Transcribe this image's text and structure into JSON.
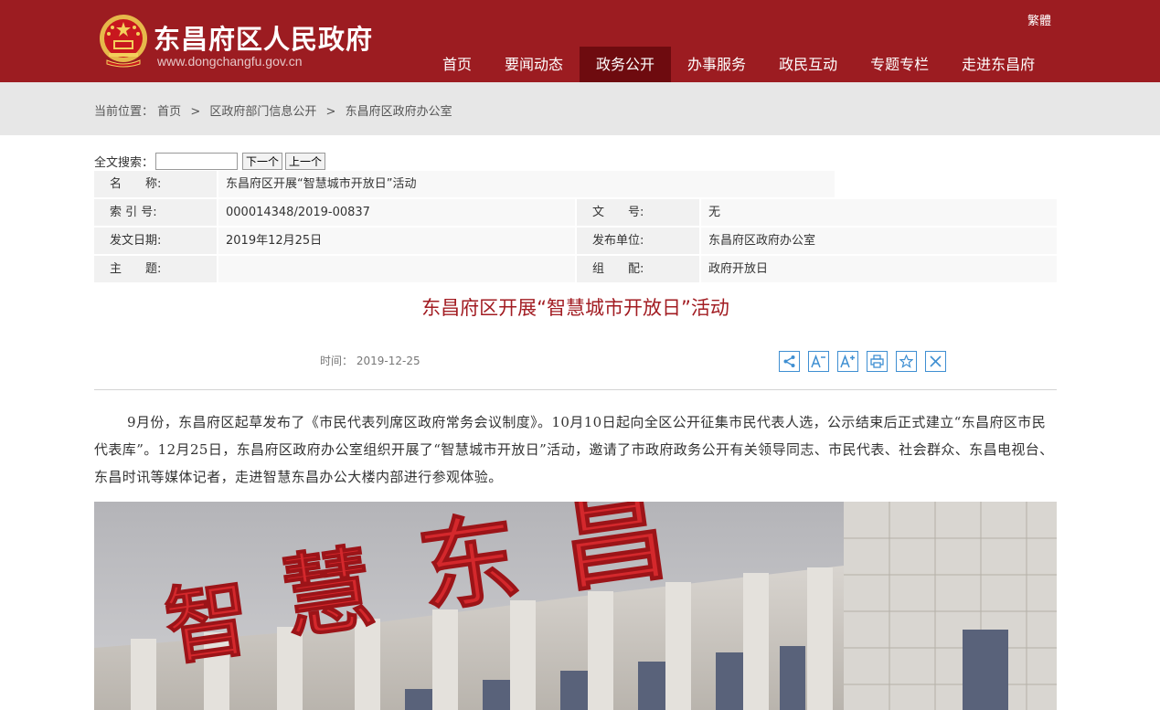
{
  "header": {
    "site_title": "东昌府区人民政府",
    "site_url": "www.dongchangfu.gov.cn",
    "lang_toggle": "繁體",
    "nav": [
      "首页",
      "要闻动态",
      "政务公开",
      "办事服务",
      "政民互动",
      "专题专栏",
      "走进东昌府"
    ],
    "nav_active": "政务公开",
    "brand_color": "#9c1c21"
  },
  "breadcrumb": {
    "prefix": "当前位置：",
    "items": [
      "首页",
      "区政府部门信息公开",
      "东昌府区政府办公室"
    ],
    "separator": ">"
  },
  "search": {
    "label": "全文搜索：",
    "value": "",
    "next_label": "下一个",
    "prev_label": "上一个"
  },
  "info": {
    "name_label": "名　　称:",
    "name_value": "东昌府区开展“智慧城市开放日”活动",
    "index_label": "索 引 号:",
    "index_value": "000014348/2019-00837",
    "docno_label": "文　　号:",
    "docno_value": "无",
    "date_label": "发文日期:",
    "date_value": "2019年12月25日",
    "publisher_label": "发布单位:",
    "publisher_value": "东昌府区政府办公室",
    "topic_label": "主　　题:",
    "topic_value": "",
    "category_label": "组　　配:",
    "category_value": "政府开放日"
  },
  "article": {
    "title": "东昌府区开展“智慧城市开放日”活动",
    "time_label": "时间：",
    "time_value": "2019-12-25",
    "body": "9月份，东昌府区起草发布了《市民代表列席区政府常务会议制度》。10月10日起向全区公开征集市民代表人选，公示结束后正式建立“东昌府区市民代表库”。12月25日，东昌府区政府办公室组织开展了“智慧城市开放日”活动，邀请了市政府政务公开有关领导同志、市民代表、社会群众、东昌电视台、东昌时讯等媒体记者，走进智慧东昌办公大楼内部进行参观体验。",
    "tools": [
      "share-icon",
      "font-decrease-icon",
      "font-increase-icon",
      "print-icon",
      "favorite-icon",
      "close-icon"
    ],
    "photo_sign": [
      "智",
      "慧",
      "东",
      "昌"
    ]
  }
}
